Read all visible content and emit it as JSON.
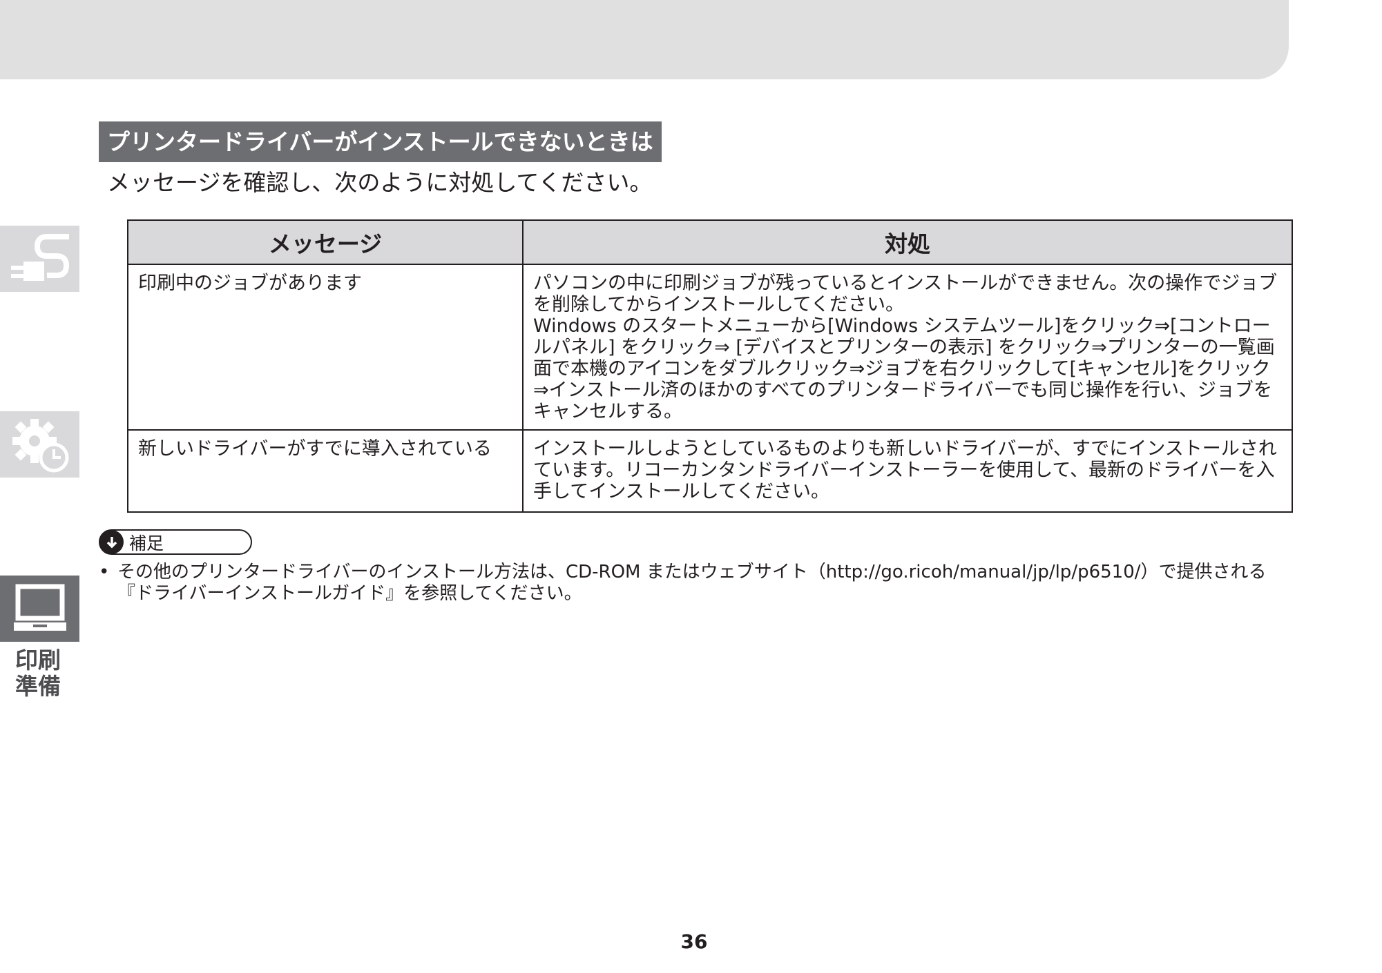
{
  "header_band": {},
  "section": {
    "heading": "プリンタードライバーがインストールできないときは",
    "intro": "メッセージを確認し、次のように対処してください。"
  },
  "table": {
    "headers": [
      "メッセージ",
      "対処"
    ],
    "rows": [
      {
        "message": "印刷中のジョブがあります",
        "action": [
          "パソコンの中に印刷ジョブが残っているとインストールができません。次の操作でジョブを削除してからインストールしてください。",
          "Windows のスタートメニューから[Windows システムツール]をクリック⇒[コントロールパネル] をクリック⇒ [デバイスとプリンターの表示] をクリック⇒プリンターの一覧画面で本機のアイコンをダブルクリック⇒ジョブを右クリックして[キャンセル]をクリック⇒インストール済のほかのすべてのプリンタードライバーでも同じ操作を行い、ジョブをキャンセルする。"
        ]
      },
      {
        "message": "新しいドライバーがすでに導入されている",
        "action": [
          "インストールしようとしているものよりも新しいドライバーが、すでにインストールされています。リコーカンタンドライバーインストーラーを使用して、最新のドライバーを入手してインストールしてください。"
        ]
      }
    ]
  },
  "side_nav": {
    "tabs": [
      {
        "icon": "plug-icon"
      },
      {
        "icon": "gear-clock-icon"
      },
      {
        "icon": "laptop-icon",
        "active": true
      }
    ],
    "active_label": "印刷準備"
  },
  "note": {
    "badge_label": "補足",
    "bullet": "•",
    "text": "その他のプリンタードライバーのインストール方法は、CD-ROM またはウェブサイト（http://go.ricoh/manual/jp/lp/p6510/）で提供される『ドライバーインストールガイド』を参照してください。"
  },
  "page_number": "36",
  "colors": {
    "heading_bg": "#6d6e71",
    "table_header_bg": "#d9d9db",
    "band_gray": "#e0e0e0",
    "text": "#231f20"
  }
}
